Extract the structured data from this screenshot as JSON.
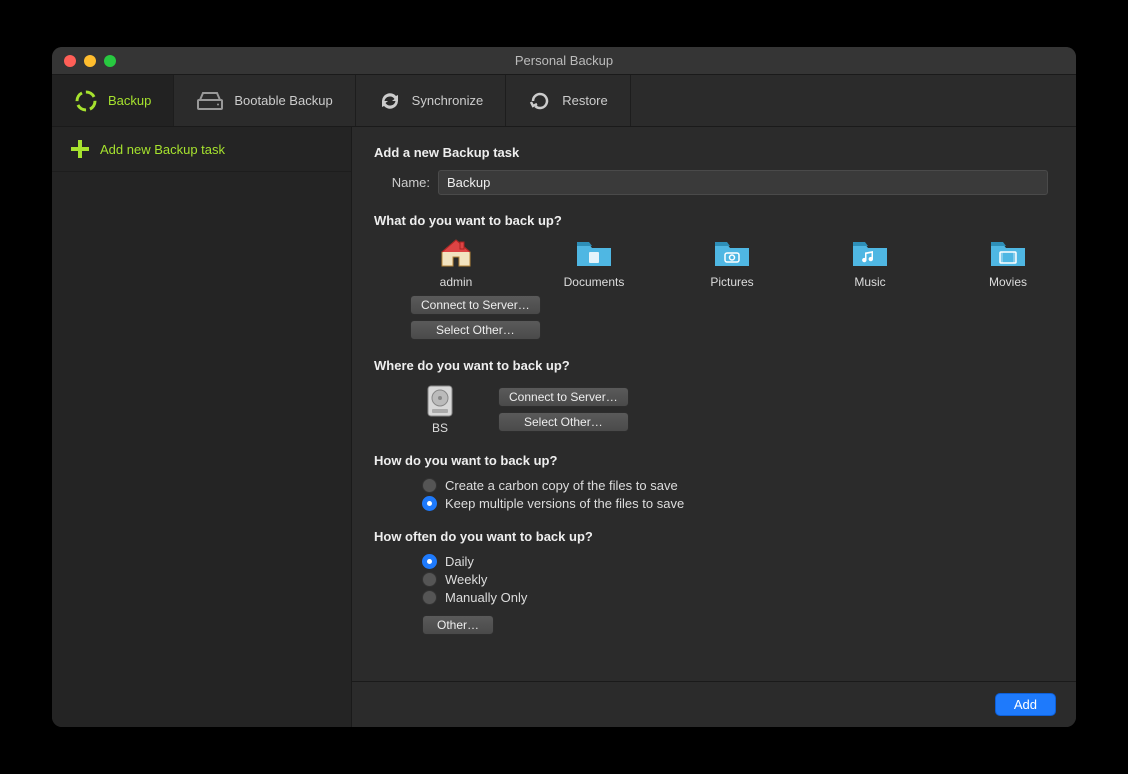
{
  "window": {
    "title": "Personal Backup"
  },
  "tabs": [
    {
      "label": "Backup"
    },
    {
      "label": "Bootable Backup"
    },
    {
      "label": "Synchronize"
    },
    {
      "label": "Restore"
    }
  ],
  "sidebar": {
    "add_task_label": "Add new Backup task"
  },
  "form": {
    "heading": "Add a new Backup task",
    "name_label": "Name:",
    "name_value": "Backup",
    "what_heading": "What do you want to back up?",
    "sources": {
      "admin": "admin",
      "documents": "Documents",
      "pictures": "Pictures",
      "music": "Music",
      "movies": "Movies"
    },
    "connect_btn": "Connect to Server…",
    "select_other_btn": "Select Other…",
    "where_heading": "Where do you want to back up?",
    "dest_name": "BS",
    "how_heading": "How do you want to back up?",
    "how_options": [
      "Create a carbon copy of the files to save",
      "Keep multiple versions of the files to save"
    ],
    "freq_heading": "How often do you want to back up?",
    "freq_options": [
      "Daily",
      "Weekly",
      "Manually Only"
    ],
    "other_btn": "Other…"
  },
  "footer": {
    "add_btn": "Add"
  }
}
